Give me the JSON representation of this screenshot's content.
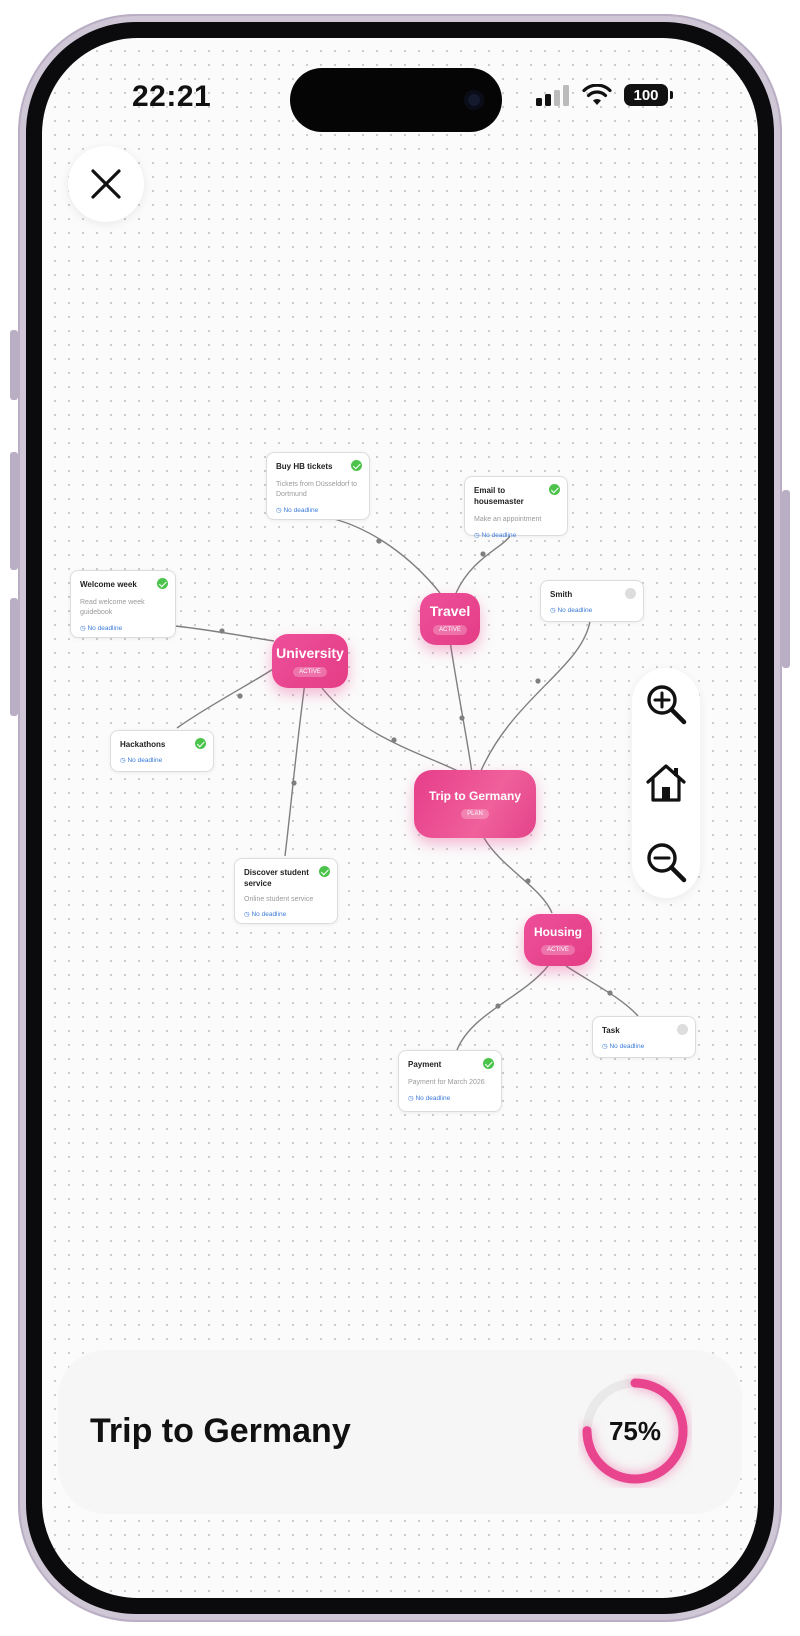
{
  "status_bar": {
    "time": "22:21",
    "battery": "100"
  },
  "close_button": {
    "icon": "close-icon"
  },
  "colors": {
    "accent": "#e9458f",
    "check": "#4cc44c",
    "deadline": "#3b7bd9"
  },
  "nodes": {
    "travel": {
      "title": "Travel",
      "badge": "ACTIVE"
    },
    "university": {
      "title": "University",
      "badge": "ACTIVE"
    },
    "trip": {
      "title": "Trip to Germany",
      "badge": "PLAN"
    },
    "housing": {
      "title": "Housing",
      "badge": "ACTIVE"
    }
  },
  "cards": {
    "buy_tickets": {
      "title": "Buy HB tickets",
      "desc": "Tickets from Düsseldorf to Dortmund",
      "deadline": "No deadline",
      "done": true
    },
    "email": {
      "title": "Email to housemaster",
      "desc": "Make an appointment",
      "deadline": "No deadline",
      "done": true
    },
    "welcome": {
      "title": "Welcome week",
      "desc": "Read welcome week guidebook",
      "deadline": "No deadline",
      "done": true
    },
    "smith": {
      "title": "Smith",
      "deadline": "No deadline",
      "done": false
    },
    "hackathons": {
      "title": "Hackathons",
      "deadline": "No deadline",
      "done": true
    },
    "discover": {
      "title": "Discover student service",
      "desc": "Online student service",
      "deadline": "No deadline",
      "done": true
    },
    "task": {
      "title": "Task",
      "deadline": "No deadline",
      "done": false
    },
    "payment": {
      "title": "Payment",
      "desc": "Payment for March 2026",
      "deadline": "No deadline",
      "done": true
    }
  },
  "zoom_controls": {
    "zoom_in": "zoom-in-icon",
    "home": "home-icon",
    "zoom_out": "zoom-out-icon"
  },
  "bottom": {
    "title": "Trip to Germany",
    "progress": 0.75,
    "progress_label": "75%"
  }
}
